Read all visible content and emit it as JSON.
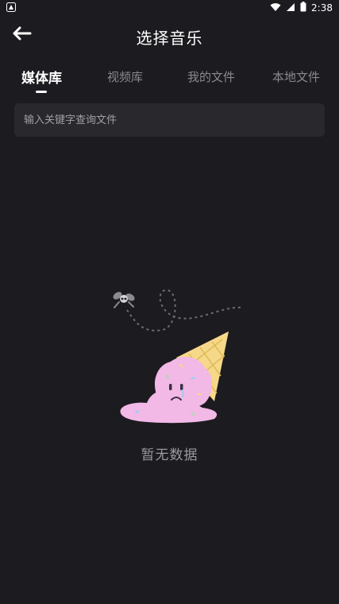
{
  "status_bar": {
    "time": "2:38",
    "icons": [
      "app-notification-icon",
      "wifi-icon",
      "signal-icon",
      "battery-icon"
    ]
  },
  "header": {
    "title": "选择音乐",
    "back_icon": "back-arrow-icon"
  },
  "tabs": [
    {
      "label": "媒体库",
      "active": true
    },
    {
      "label": "视频库",
      "active": false
    },
    {
      "label": "我的文件",
      "active": false
    },
    {
      "label": "本地文件",
      "active": false
    }
  ],
  "search": {
    "placeholder": "输入关键字查询文件",
    "value": ""
  },
  "empty_state": {
    "text": "暂无数据",
    "illustration": "melted-ice-cream-illustration"
  },
  "colors": {
    "background": "#1c1b1f",
    "search_bg": "#29282d",
    "inactive_tab": "#8a8a8e",
    "ice_cream": "#f2b8e6",
    "cone": "#f6d889"
  }
}
